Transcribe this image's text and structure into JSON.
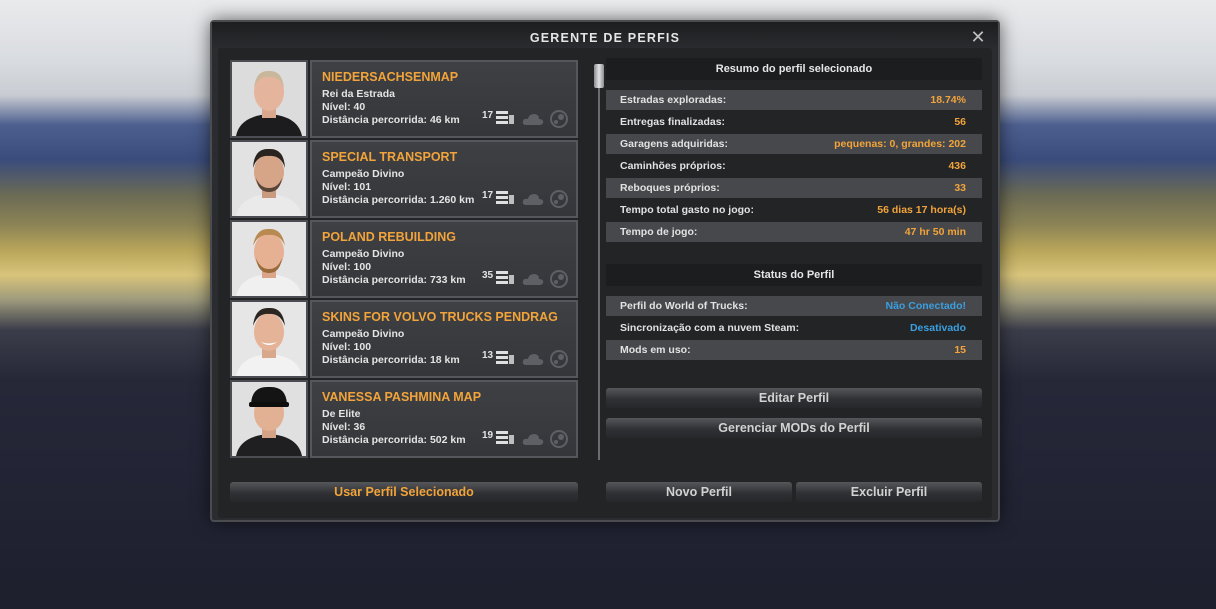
{
  "dialog": {
    "title": "GERENTE DE PERFIS",
    "close_symbol": "✕",
    "close_icon": "close-icon"
  },
  "profiles": [
    {
      "name": "NIEDERSACHSENMAP",
      "rank": "Rei da Estrada",
      "level": "Nível: 40",
      "distance": "Distância percorrida: 46 km",
      "count": "17"
    },
    {
      "name": "SPECIAL TRANSPORT",
      "rank": "Campeão Divino",
      "level": "Nível: 101",
      "distance": "Distância percorrida: 1.260 km",
      "count": "17"
    },
    {
      "name": "POLAND REBUILDING",
      "rank": "Campeão Divino",
      "level": "Nível: 100",
      "distance": "Distância percorrida: 733 km",
      "count": "35"
    },
    {
      "name": "SKINS FOR VOLVO TRUCKS PENDRAG",
      "rank": "Campeão Divino",
      "level": "Nível: 100",
      "distance": "Distância percorrida: 18 km",
      "count": "13"
    },
    {
      "name": "VANESSA PASHMINA MAP",
      "rank": "De Elite",
      "level": "Nível: 36",
      "distance": "Distância percorrida: 502 km",
      "count": "19"
    }
  ],
  "icons": {
    "truck": "truck-icon",
    "cloud": "cloud-icon",
    "steam": "steam-icon"
  },
  "buttons": {
    "use_profile": "Usar Perfil Selecionado",
    "edit_profile": "Editar Perfil",
    "manage_mods": "Gerenciar MODs do Perfil",
    "new_profile": "Novo Perfil",
    "delete_profile": "Excluir Perfil"
  },
  "summary": {
    "header": "Resumo do perfil selecionado",
    "rows": [
      {
        "label": "Estradas exploradas:",
        "value": "18.74%"
      },
      {
        "label": "Entregas finalizadas:",
        "value": "56"
      },
      {
        "label": "Garagens adquiridas:",
        "value": "pequenas: 0, grandes: 202"
      },
      {
        "label": "Caminhões próprios:",
        "value": "436"
      },
      {
        "label": "Reboques próprios:",
        "value": "33"
      },
      {
        "label": "Tempo total gasto no jogo:",
        "value": "56 dias 17 hora(s)"
      },
      {
        "label": "Tempo de jogo:",
        "value": "47 hr 50 min"
      }
    ]
  },
  "status": {
    "header": "Status do Perfil",
    "rows": [
      {
        "label": "Perfil do World of Trucks:",
        "value": "Não Conectado!"
      },
      {
        "label": "Sincronização com a nuvem Steam:",
        "value": "Desativado"
      },
      {
        "label": "Mods em uso:",
        "value": "15"
      }
    ]
  },
  "colors": {
    "accent_orange": "#f2a43a",
    "link_blue": "#3b9fe0",
    "panel_dark": "#232426",
    "row_light": "#46484c"
  }
}
